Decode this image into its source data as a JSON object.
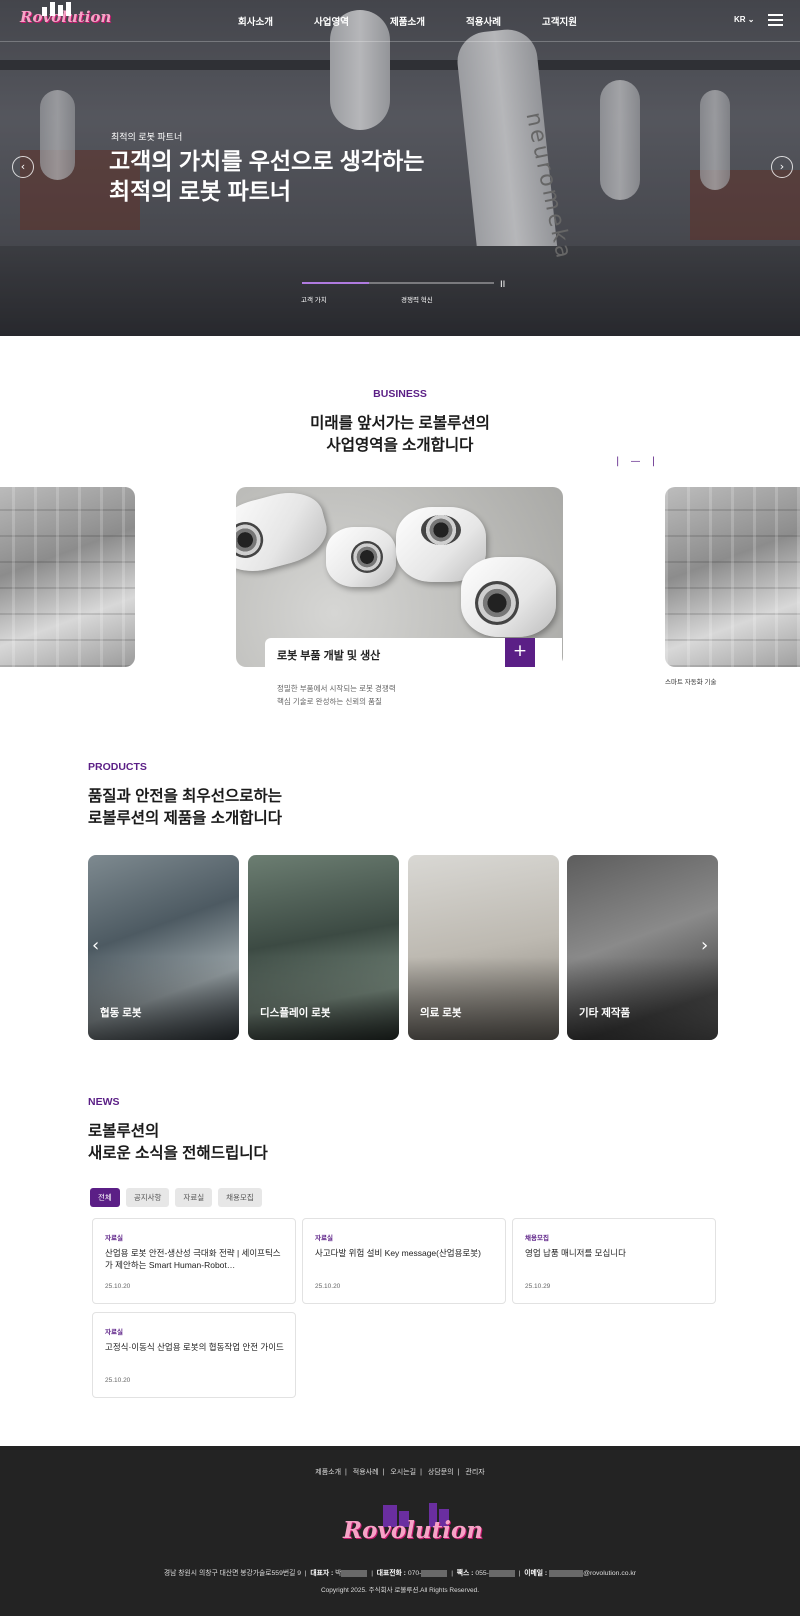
{
  "brand": {
    "logo_text": "Rovolution"
  },
  "nav": {
    "items": [
      "회사소개",
      "사업영역",
      "제품소개",
      "적용사례",
      "고객지원"
    ],
    "lang": "KR"
  },
  "hero": {
    "subtitle": "최적의 로봇 파트너",
    "title_line1": "고객의 가치를 우선으로 생각하는",
    "title_line2": "최적의 로봇 파트너",
    "arm_brand": "neuromeka",
    "steps": [
      "고객 가치",
      "경쟁력 혁신"
    ],
    "progress": 0.35
  },
  "business": {
    "label": "BUSINESS",
    "title_line1": "미래를 앞서가는 로볼루션의",
    "title_line2": "사업영역을 소개합니다",
    "pager": "| — |",
    "card_title": "로봇 부품 개발 및 생산",
    "card_desc_line1": "정밀한 부품에서 시작되는 로봇 경쟁력",
    "card_desc_line2": "핵심 기술로 완성하는 신뢰의 품질",
    "side_label": "스마트 자동화 기술"
  },
  "products": {
    "label": "PRODUCTS",
    "title_line1": "품질과 안전을 최우선으로하는",
    "title_line2": "로볼루션의 제품을 소개합니다",
    "items": [
      "협동 로봇",
      "디스플레이 로봇",
      "의료 로봇",
      "기타 제작품"
    ]
  },
  "news": {
    "label": "NEWS",
    "title_line1": "로볼루션의",
    "title_line2": "새로운 소식을 전해드립니다",
    "tabs": [
      "전체",
      "공지사항",
      "자료실",
      "채용모집"
    ],
    "cards": [
      {
        "cat": "자료실",
        "title": "산업용 로봇 안전-생산성 극대화 전략 | 세이프틱스가 제안하는 Smart Human-Robot…",
        "date": "25.10.20"
      },
      {
        "cat": "자료실",
        "title": "사고다발 위험 설비 Key message(산업용로봇)",
        "date": "25.10.20"
      },
      {
        "cat": "채용모집",
        "title": "영업 납품 매니저를 모십니다",
        "date": "25.10.29"
      },
      {
        "cat": "자료실",
        "title": "고정식·이동식 산업용 로봇의 협동작업 안전 가이드",
        "date": "25.10.20"
      }
    ]
  },
  "footer": {
    "links": [
      "제품소개",
      "적용사례",
      "오시는길",
      "상담문의",
      "관리자"
    ],
    "address": "경남 창원시 의창구 대산면 봉강가술로559번길 9",
    "ceo_label": "대표자 :",
    "ceo": "박",
    "phone_label": "대표전화 :",
    "phone": "070-",
    "fax_label": "팩스 :",
    "fax": "055-",
    "email_label": "이메일 :",
    "email": "@rovolution.co.kr",
    "copyright": "Copyright 2025. 주식회사 로볼루션.All Rights Reserved."
  },
  "colors": {
    "accent": "#5b1f86",
    "footer_bg": "#232323"
  }
}
